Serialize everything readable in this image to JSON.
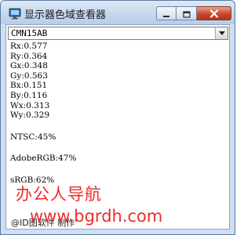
{
  "window": {
    "title": "显示器色域查看器",
    "icon": "monitor-icon"
  },
  "controls": {
    "minimize_icon": "minimize-icon",
    "maximize_icon": "maximize-icon",
    "close_icon": "close-icon"
  },
  "monitor_select": {
    "value": "CMN15AB"
  },
  "chromaticity": [
    "Rx:0.577",
    "Ry:0.364",
    "Gx:0.348",
    "Gy:0.563",
    "Bx:0.151",
    "By:0.116",
    "Wx:0.313",
    "Wy:0.329"
  ],
  "gamut": {
    "ntsc": "NTSC:45%",
    "adobergb": "AdobeRGB:47%",
    "srgb": "sRGB:62%"
  },
  "watermark": {
    "title": "办公人导航",
    "url": "www.bgrdh.com"
  },
  "footer": {
    "text": "@ID图软件 制作"
  },
  "colors": {
    "watermark": "#ef2b2b",
    "title_bar": "#c7d9ee",
    "close_button": "#c9472c"
  }
}
